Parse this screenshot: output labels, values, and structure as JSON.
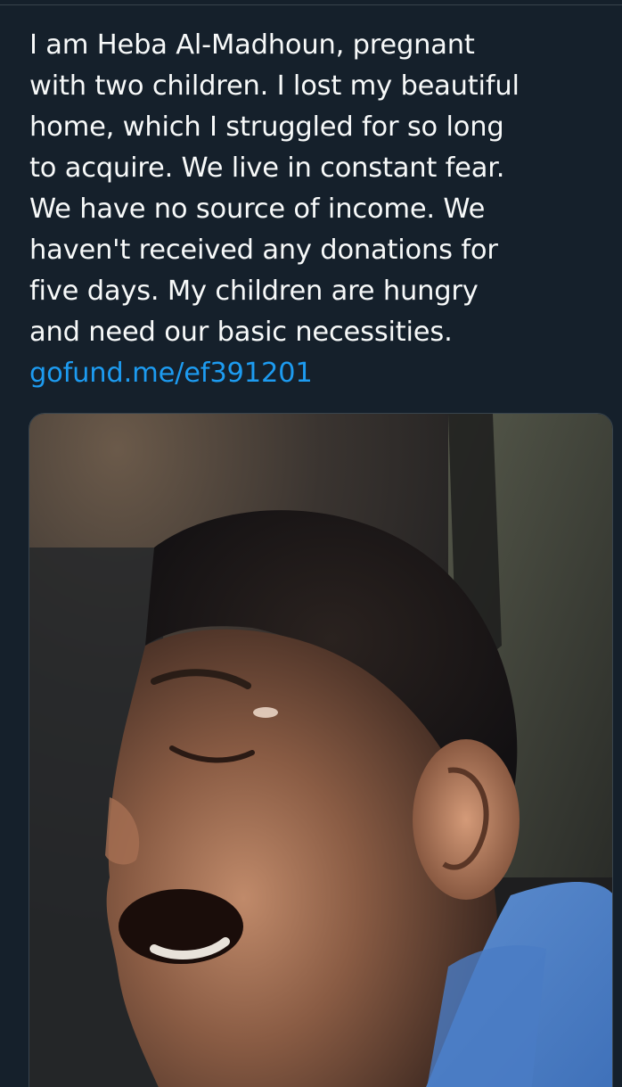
{
  "tweet": {
    "text_lines": [
      "I am Heba Al-Madhoun, pregnant",
      "with two children. I lost my beautiful",
      "home, which I struggled for so long",
      "to acquire. We live in constant fear.",
      "We have no source of income. We",
      "haven't received any donations for",
      "five days. My children are hungry",
      "and need our basic necessities."
    ],
    "link": "gofund.me/ef391201"
  },
  "media": {
    "subject": "photo-child-crying"
  },
  "colors": {
    "background": "#15202b",
    "text": "#f7f9f9",
    "link": "#1d9bf0",
    "border": "#38444d"
  }
}
